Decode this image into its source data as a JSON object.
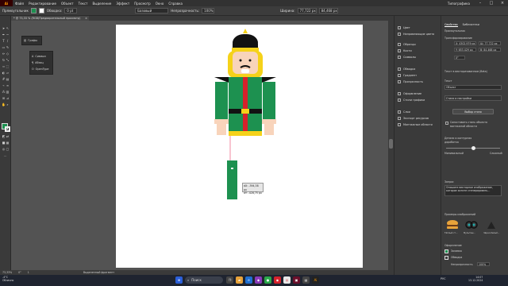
{
  "app": {
    "logo": "Ai",
    "workspace": "Типографика"
  },
  "menubar": [
    "Файл",
    "Редактирование",
    "Объект",
    "Текст",
    "Выделение",
    "Эффект",
    "Просмотр",
    "Окно",
    "Справка"
  ],
  "control": {
    "selection": "Прямоугольник",
    "stroke_label": "Обводка:",
    "stroke_value": "0 pt",
    "style": "Базовый",
    "opacity_label": "Непрозрачность:",
    "opacity_value": "100%",
    "width_label": "Ширина:",
    "width_value": "77,722 px",
    "height_value": "84,468 px"
  },
  "document": {
    "tab_title": "* @ 73,33 % (RGB/Предварительный просмотр)",
    "close": "×"
  },
  "flyout": {
    "label": "Графы"
  },
  "flyout_items": [
    "Символ",
    "Абзац",
    "OpenType"
  ],
  "measure": {
    "dx": "dX: -394,38 px",
    "dy": "dY: -428,75 px"
  },
  "status": {
    "zoom": "73,33%",
    "angle": "0°",
    "page": "1",
    "tool": "Выделенный фрагмент"
  },
  "minicol": [
    "Цвет",
    "Направляющие цвета",
    "Образцы",
    "Кисти",
    "Символы",
    "Обводка",
    "Градиент",
    "Прозрачность",
    "Оформление",
    "Стили графики",
    "Слои",
    "Экспорт ресурсов",
    "Монтажные области"
  ],
  "panel": {
    "tabs": [
      "Свойства",
      "Библиотеки"
    ],
    "object_label": "Прямоугольник",
    "transform_title": "Трансформирование",
    "x": "X: 4302,979 px",
    "y": "Y: 653,429 px",
    "w": "Ш: 77,722 px",
    "h": "В: 84,468 px",
    "angle": "0°",
    "text_vectorize_title": "Текст в векторизованном (Beta)",
    "text_label": "Текст",
    "object_select": "Объект",
    "style_title": "Стили и настройки",
    "choose_style": "Выбор стиля",
    "match_label": "Сопоставить стиль объекта",
    "match_sub": "монтажной области",
    "detail_label": "Детали и контурная",
    "detail_sub": "доработка",
    "min_label": "Минимальный",
    "max_label": "Сложный",
    "prompt_label": "Запрос",
    "prompt_text": "Опишите векторное изображение, которое хотите сгенерировать...",
    "examples_title": "Примеры изображений",
    "example_1": "Тёплый ст...",
    "example_2": "Мультяш...",
    "example_3": "Чёрно-белый...",
    "appearance_title": "Оформление",
    "fill_label": "Заливка",
    "stroke_label": "Обводка",
    "opacity_label": "Непрозрачность",
    "opacity_value": "100%"
  },
  "taskbar": {
    "weather_temp": "-4°C",
    "weather_desc": "Облачно",
    "search": "Поиск",
    "lang": "РУС",
    "time": "14:07",
    "date": "13.12.2024"
  },
  "colors": {
    "green": "#1d9150",
    "red": "#d6212b",
    "yellow": "#f5d21a",
    "skin": "#f8d4bb",
    "black": "#121212"
  }
}
